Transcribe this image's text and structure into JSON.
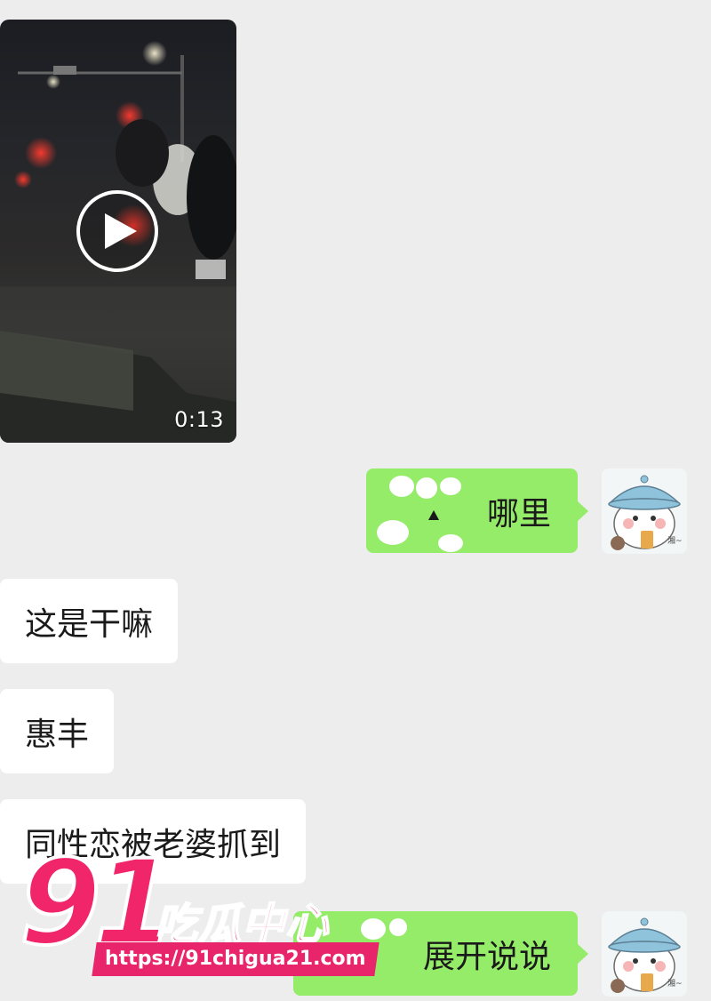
{
  "chat": {
    "video": {
      "duration": "0:13"
    },
    "messages": [
      {
        "side": "out",
        "text": "哪里"
      },
      {
        "side": "in",
        "text": "这是干嘛"
      },
      {
        "side": "in",
        "text": "惠丰"
      },
      {
        "side": "in",
        "text": "同性恋被老婆抓到"
      },
      {
        "side": "out",
        "text": "展开说说"
      }
    ],
    "avatar_caption": "湘~"
  },
  "watermark": {
    "number": "91",
    "title": "吃瓜中心",
    "url": "https://91chigua21.com"
  },
  "colors": {
    "background": "#ededed",
    "bubble_out": "#95ec69",
    "bubble_in": "#ffffff",
    "watermark_pink": "#f0256a"
  }
}
